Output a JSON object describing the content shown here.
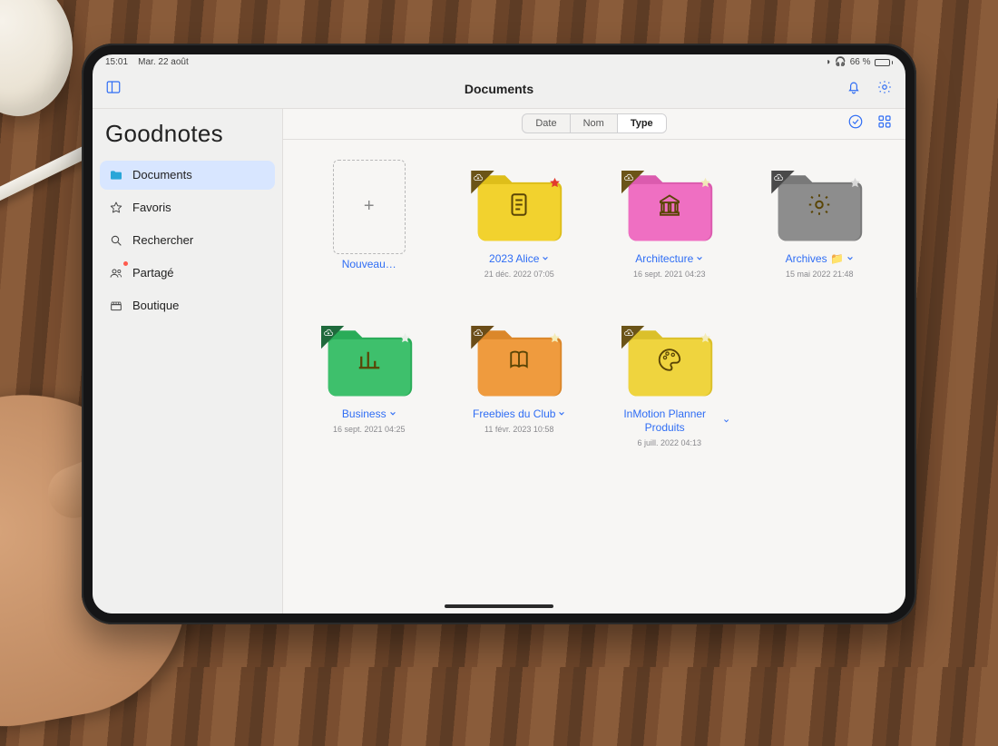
{
  "status": {
    "time": "15:01",
    "date": "Mar. 22 août",
    "battery": "66 %"
  },
  "header": {
    "title": "Documents"
  },
  "app": {
    "title": "Goodnotes"
  },
  "sidebar": {
    "items": [
      {
        "icon": "folder-icon",
        "label": "Documents",
        "selected": true
      },
      {
        "icon": "star-icon",
        "label": "Favoris"
      },
      {
        "icon": "search-icon",
        "label": "Rechercher"
      },
      {
        "icon": "people-icon",
        "label": "Partagé",
        "badge": true
      },
      {
        "icon": "shop-icon",
        "label": "Boutique"
      }
    ]
  },
  "sort": {
    "segments": [
      "Date",
      "Nom",
      "Type"
    ],
    "selected": 2
  },
  "grid": {
    "new_label": "Nouveau…",
    "folders": [
      {
        "name": "2023 Alice",
        "date": "21 déc. 2022 07:05",
        "color": "#f2d22e",
        "icon": "doc-icon",
        "star": "#e23b2e",
        "corner": "#6b5418"
      },
      {
        "name": "Architecture",
        "date": "16 sept. 2021 04:23",
        "color": "#ef6fc2",
        "icon": "bank-icon",
        "star": "#f0e9b8",
        "corner": "#6b5418"
      },
      {
        "name": "Archives",
        "date": "15 mai 2022 21:48",
        "color": "#8d8d8d",
        "icon": "gear-icon",
        "star": "#d8d8d8",
        "corner": "#4a4a4a",
        "name_badge": "📁"
      },
      {
        "name": "Business",
        "date": "16 sept. 2021 04:25",
        "color": "#3ec06c",
        "icon": "chart-icon",
        "star": "#e8efe8",
        "corner": "#1f6a3c"
      },
      {
        "name": "Freebies du Club",
        "date": "11 févr. 2023 10:58",
        "color": "#ef9b3e",
        "icon": "book-icon",
        "star": "#f4ecb8",
        "corner": "#6b4d18"
      },
      {
        "name": "InMotion Planner Produits",
        "date": "6 juill. 2022 04:13",
        "color": "#efd43e",
        "icon": "palette-icon",
        "star": "#f4ecb8",
        "corner": "#6b5418"
      }
    ]
  }
}
